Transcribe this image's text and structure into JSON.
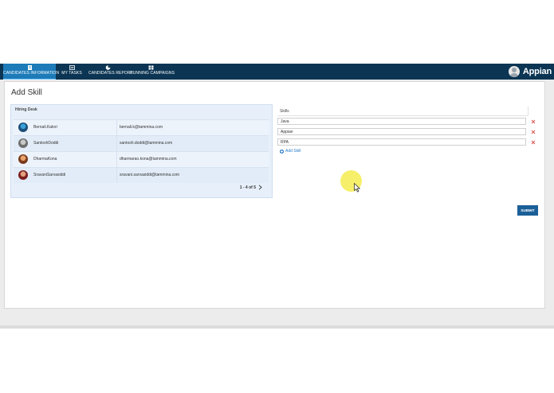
{
  "nav": {
    "items": [
      {
        "label": "CANDIDATES INFORMATION",
        "icon": "document-icon",
        "active": true
      },
      {
        "label": "MY TASKS",
        "icon": "tasks-icon",
        "active": false
      },
      {
        "label": "CANDIDATES REPORT",
        "icon": "pie-chart-icon",
        "active": false
      },
      {
        "label": "RUNNING CAMPAIGNS",
        "icon": "grid-icon",
        "active": false
      }
    ],
    "brand": "Appian"
  },
  "page": {
    "title": "Add Skill"
  },
  "hiring_desk": {
    "title": "Hiring Desk",
    "rows": [
      {
        "name": "Bernali.Kalori",
        "email": "bernali.k@tammina.com"
      },
      {
        "name": "SantoshDoddi",
        "email": "santosh.doddi@tammina.com"
      },
      {
        "name": "DharmaKona",
        "email": "dharmarao.kona@tammina.com"
      },
      {
        "name": "SravaniSarvasiddi",
        "email": "sravani.sarvasiddi@tammina.com"
      }
    ],
    "pager": "1 - 4 of 5"
  },
  "skills": {
    "header": "Skills",
    "items": [
      "Java",
      "Appian",
      "RPA"
    ],
    "add_label": "Add Skill"
  },
  "actions": {
    "submit_label": "SUBMIT"
  },
  "colors": {
    "nav_bg": "#0b3553",
    "nav_active": "#1d7bb8",
    "card_bg": "#e7f0fa",
    "remove_x": "#d9534f",
    "link": "#2b7cc6",
    "submit": "#1b5f98"
  }
}
